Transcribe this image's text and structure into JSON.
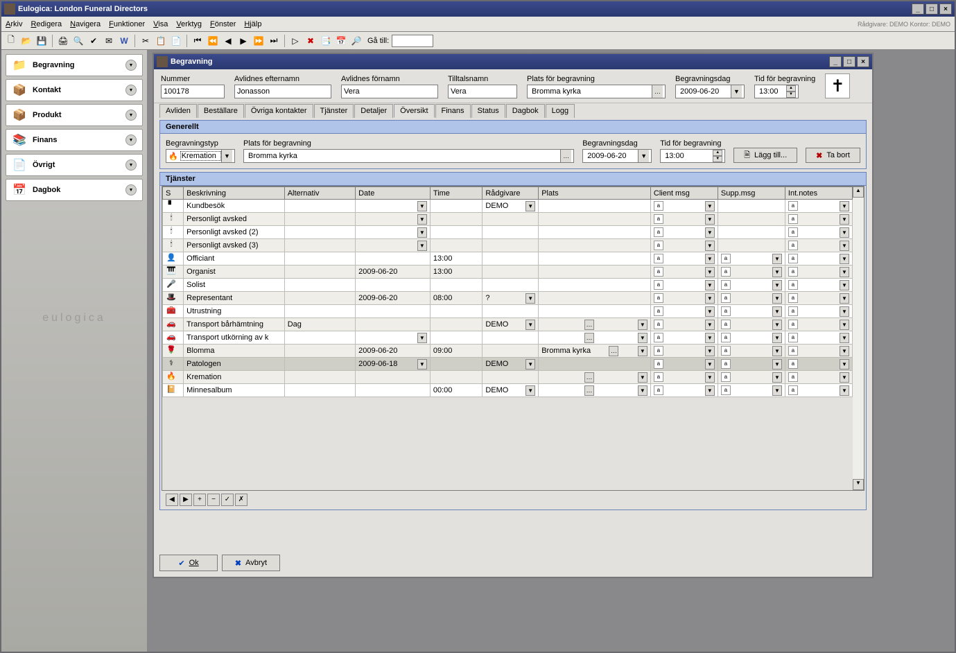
{
  "app": {
    "title": "Eulogica: London Funeral Directors",
    "status_text": "Rådgivare: DEMO   Kontor: DEMO"
  },
  "menu": [
    "Arkiv",
    "Redigera",
    "Navigera",
    "Funktioner",
    "Visa",
    "Verktyg",
    "Fönster",
    "Hjälp"
  ],
  "toolbar": {
    "goto_label": "Gå till:",
    "goto_value": ""
  },
  "sidebar": {
    "items": [
      {
        "label": "Begravning",
        "icon": "📁"
      },
      {
        "label": "Kontakt",
        "icon": "📦"
      },
      {
        "label": "Produkt",
        "icon": "📦"
      },
      {
        "label": "Finans",
        "icon": "📚"
      },
      {
        "label": "Övrigt",
        "icon": "📄"
      },
      {
        "label": "Dagbok",
        "icon": "📅"
      }
    ],
    "logo_text": "eulogica"
  },
  "mdi": {
    "title": "Begravning",
    "header": {
      "nummer_label": "Nummer",
      "nummer": "100178",
      "efternamn_label": "Avlidnes efternamn",
      "efternamn": "Jonasson",
      "fornamn_label": "Avlidnes förnamn",
      "fornamn": "Vera",
      "tilltal_label": "Tilltalsnamn",
      "tilltal": "Vera",
      "plats_label": "Plats för begravning",
      "plats": "Bromma kyrka",
      "dag_label": "Begravningsdag",
      "dag": "2009-06-20",
      "tid_label": "Tid för begravning",
      "tid": "13:00"
    },
    "tabs": [
      "Avliden",
      "Beställare",
      "Övriga kontakter",
      "Tjänster",
      "Detaljer",
      "Översikt",
      "Finans",
      "Status",
      "Dagbok",
      "Logg"
    ],
    "active_tab": "Översikt",
    "general": {
      "header": "Generellt",
      "typ_label": "Begravningstyp",
      "typ": "Kremation",
      "plats_label": "Plats för begravning",
      "plats": "Bromma kyrka",
      "dag_label": "Begravningsdag",
      "dag": "2009-06-20",
      "tid_label": "Tid för begravning",
      "tid": "13:00",
      "add_btn": "Lägg till...",
      "del_btn": "Ta bort"
    },
    "services": {
      "header": "Tjänster",
      "columns": [
        "S",
        "Beskrivning",
        "Alternativ",
        "Date",
        "Time",
        "Rådgivare",
        "Plats",
        "Client msg",
        "Supp.msg",
        "Int.notes"
      ],
      "rows": [
        {
          "icon": "▘",
          "desc": "Kundbesök",
          "alt": "",
          "date": "",
          "date_dd": true,
          "time": "",
          "rad": "DEMO",
          "rad_dd": true,
          "plats": "",
          "plats_dd": false,
          "cm": true,
          "sm": false,
          "in": true,
          "in_dd": true,
          "alt_row": false
        },
        {
          "icon": "🕯",
          "desc": "Personligt avsked",
          "alt": "",
          "date": "",
          "date_dd": true,
          "time": "",
          "rad": "",
          "rad_dd": false,
          "plats": "",
          "plats_dd": false,
          "cm": true,
          "sm": false,
          "in": true,
          "in_dd": true,
          "alt_row": true
        },
        {
          "icon": "🕯",
          "desc": "Personligt avsked (2)",
          "alt": "",
          "date": "",
          "date_dd": true,
          "time": "",
          "rad": "",
          "rad_dd": false,
          "plats": "",
          "plats_dd": false,
          "cm": true,
          "sm": false,
          "in": true,
          "in_dd": true,
          "alt_row": false
        },
        {
          "icon": "🕯",
          "desc": "Personligt avsked (3)",
          "alt": "",
          "date": "",
          "date_dd": true,
          "time": "",
          "rad": "",
          "rad_dd": false,
          "plats": "",
          "plats_dd": false,
          "cm": true,
          "sm": false,
          "in": true,
          "in_dd": true,
          "alt_row": true
        },
        {
          "icon": "👤",
          "desc": "Officiant",
          "alt": "",
          "date": "",
          "date_dd": false,
          "time": "13:00",
          "rad": "",
          "rad_dd": false,
          "plats": "",
          "plats_dd": false,
          "cm": true,
          "sm": true,
          "in": true,
          "in_dd": true,
          "alt_row": false
        },
        {
          "icon": "🎹",
          "desc": "Organist",
          "alt": "",
          "date": "2009-06-20",
          "date_dd": false,
          "time": "13:00",
          "rad": "",
          "rad_dd": false,
          "plats": "",
          "plats_dd": false,
          "cm": true,
          "sm": true,
          "in": true,
          "in_dd": true,
          "alt_row": true
        },
        {
          "icon": "🎤",
          "desc": "Solist",
          "alt": "",
          "date": "",
          "date_dd": false,
          "time": "",
          "rad": "",
          "rad_dd": false,
          "plats": "",
          "plats_dd": false,
          "cm": true,
          "sm": true,
          "in": true,
          "in_dd": true,
          "alt_row": false
        },
        {
          "icon": "🎩",
          "desc": "Representant",
          "alt": "",
          "date": "2009-06-20",
          "date_dd": false,
          "time": "08:00",
          "rad": "?",
          "rad_dd": true,
          "plats": "",
          "plats_dd": false,
          "cm": true,
          "sm": true,
          "in": true,
          "in_dd": true,
          "alt_row": true
        },
        {
          "icon": "🧰",
          "desc": "Utrustning",
          "alt": "",
          "date": "",
          "date_dd": false,
          "time": "",
          "rad": "",
          "rad_dd": false,
          "plats": "",
          "plats_dd": false,
          "cm": true,
          "sm": true,
          "in": true,
          "in_dd": true,
          "alt_row": false
        },
        {
          "icon": "🚗",
          "desc": "Transport bårhämtning",
          "alt": "Dag",
          "date": "",
          "date_dd": false,
          "time": "",
          "rad": "DEMO",
          "rad_dd": true,
          "plats": "",
          "plats_dots": true,
          "plats_dd": true,
          "cm": true,
          "sm": true,
          "in": true,
          "in_dd": true,
          "alt_row": true
        },
        {
          "icon": "🚗",
          "desc": "Transport utkörning av k",
          "alt": "",
          "date": "",
          "date_dd": true,
          "time": "",
          "rad": "",
          "rad_dd": false,
          "plats": "",
          "plats_dots": true,
          "plats_dd": true,
          "cm": true,
          "sm": true,
          "in": true,
          "in_dd": true,
          "alt_row": false
        },
        {
          "icon": "🌹",
          "desc": "Blomma",
          "alt": "",
          "date": "2009-06-20",
          "date_dd": false,
          "time": "09:00",
          "rad": "",
          "rad_dd": false,
          "plats": "Bromma kyrka",
          "plats_dots": true,
          "plats_dd": true,
          "cm": true,
          "sm": true,
          "in": true,
          "in_dd": true,
          "alt_row": true
        },
        {
          "icon": "⚕",
          "desc": "Patologen",
          "alt": "",
          "date": "2009-06-18",
          "date_dd": true,
          "time": "",
          "rad": "DEMO",
          "rad_dd": true,
          "plats": "",
          "plats_dd": false,
          "cm": true,
          "sm": true,
          "in": true,
          "in_dd": true,
          "alt_row": false,
          "hl": true
        },
        {
          "icon": "🔥",
          "desc": "Kremation",
          "alt": "",
          "date": "",
          "date_dd": false,
          "time": "",
          "rad": "",
          "rad_dd": false,
          "plats": "",
          "plats_dots": true,
          "plats_dd": true,
          "cm": true,
          "sm": true,
          "in": true,
          "in_dd": true,
          "alt_row": true
        },
        {
          "icon": "📔",
          "desc": "Minnesalbum",
          "alt": "",
          "date": "",
          "date_dd": false,
          "time": "00:00",
          "rad": "DEMO",
          "rad_dd": true,
          "plats": "",
          "plats_dots": true,
          "plats_dd": true,
          "cm": true,
          "sm": true,
          "in": true,
          "in_dd": true,
          "alt_row": false
        }
      ]
    },
    "footer": {
      "ok": "Ok",
      "cancel": "Avbryt"
    }
  }
}
